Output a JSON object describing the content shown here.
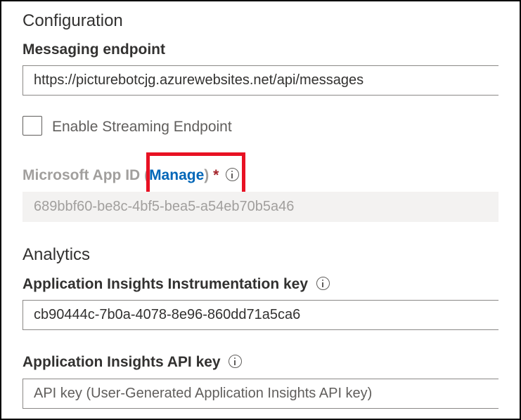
{
  "configuration": {
    "title": "Configuration",
    "messaging_endpoint": {
      "label": "Messaging endpoint",
      "value": "https://picturebotcjg.azurewebsites.net/api/messages"
    },
    "streaming": {
      "label": "Enable Streaming Endpoint",
      "checked": false
    },
    "app_id": {
      "label": "Microsoft App ID",
      "paren_open": "(",
      "manage_link": "Manage",
      "paren_close": ")",
      "required_marker": "*",
      "value": "689bbf60-be8c-4bf5-bea5-a54eb70b5a46"
    }
  },
  "analytics": {
    "title": "Analytics",
    "instrumentation_key": {
      "label": "Application Insights Instrumentation key",
      "value": "cb90444c-7b0a-4078-8e96-860dd71a5ca6"
    },
    "api_key": {
      "label": "Application Insights API key",
      "placeholder": "API key (User-Generated Application Insights API key)"
    }
  },
  "colors": {
    "link": "#0066b8",
    "required": "#a4262c",
    "highlight": "#e81123",
    "disabled_text": "#a19f9d"
  }
}
